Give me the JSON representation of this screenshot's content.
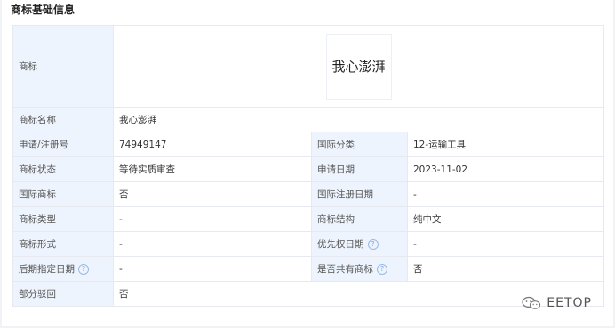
{
  "section": {
    "title": "商标基础信息"
  },
  "logo": {
    "label": "商标",
    "text": "我心澎湃"
  },
  "rows": [
    {
      "l1": "商标名称",
      "v1": "我心澎湃"
    },
    {
      "l1": "申请/注册号",
      "v1": "74949147",
      "l2": "国际分类",
      "v2": "12-运输工具"
    },
    {
      "l1": "商标状态",
      "v1": "等待实质审查",
      "l2": "申请日期",
      "v2": "2023-11-02"
    },
    {
      "l1": "国际商标",
      "v1": "否",
      "l2": "国际注册日期",
      "v2": "-"
    },
    {
      "l1": "商标类型",
      "v1": "-",
      "l2": "商标结构",
      "v2": "纯中文"
    },
    {
      "l1": "商标形式",
      "v1": "-",
      "l2": "优先权日期",
      "v2": "-"
    },
    {
      "l1": "后期指定日期",
      "v1": "-",
      "l2": "是否共有商标",
      "v2": "否"
    },
    {
      "l1": "部分驳回",
      "v1": "否"
    }
  ],
  "help_glyph": "?",
  "watermark": {
    "text": "EETOP",
    "icon": "wechat-icon"
  }
}
